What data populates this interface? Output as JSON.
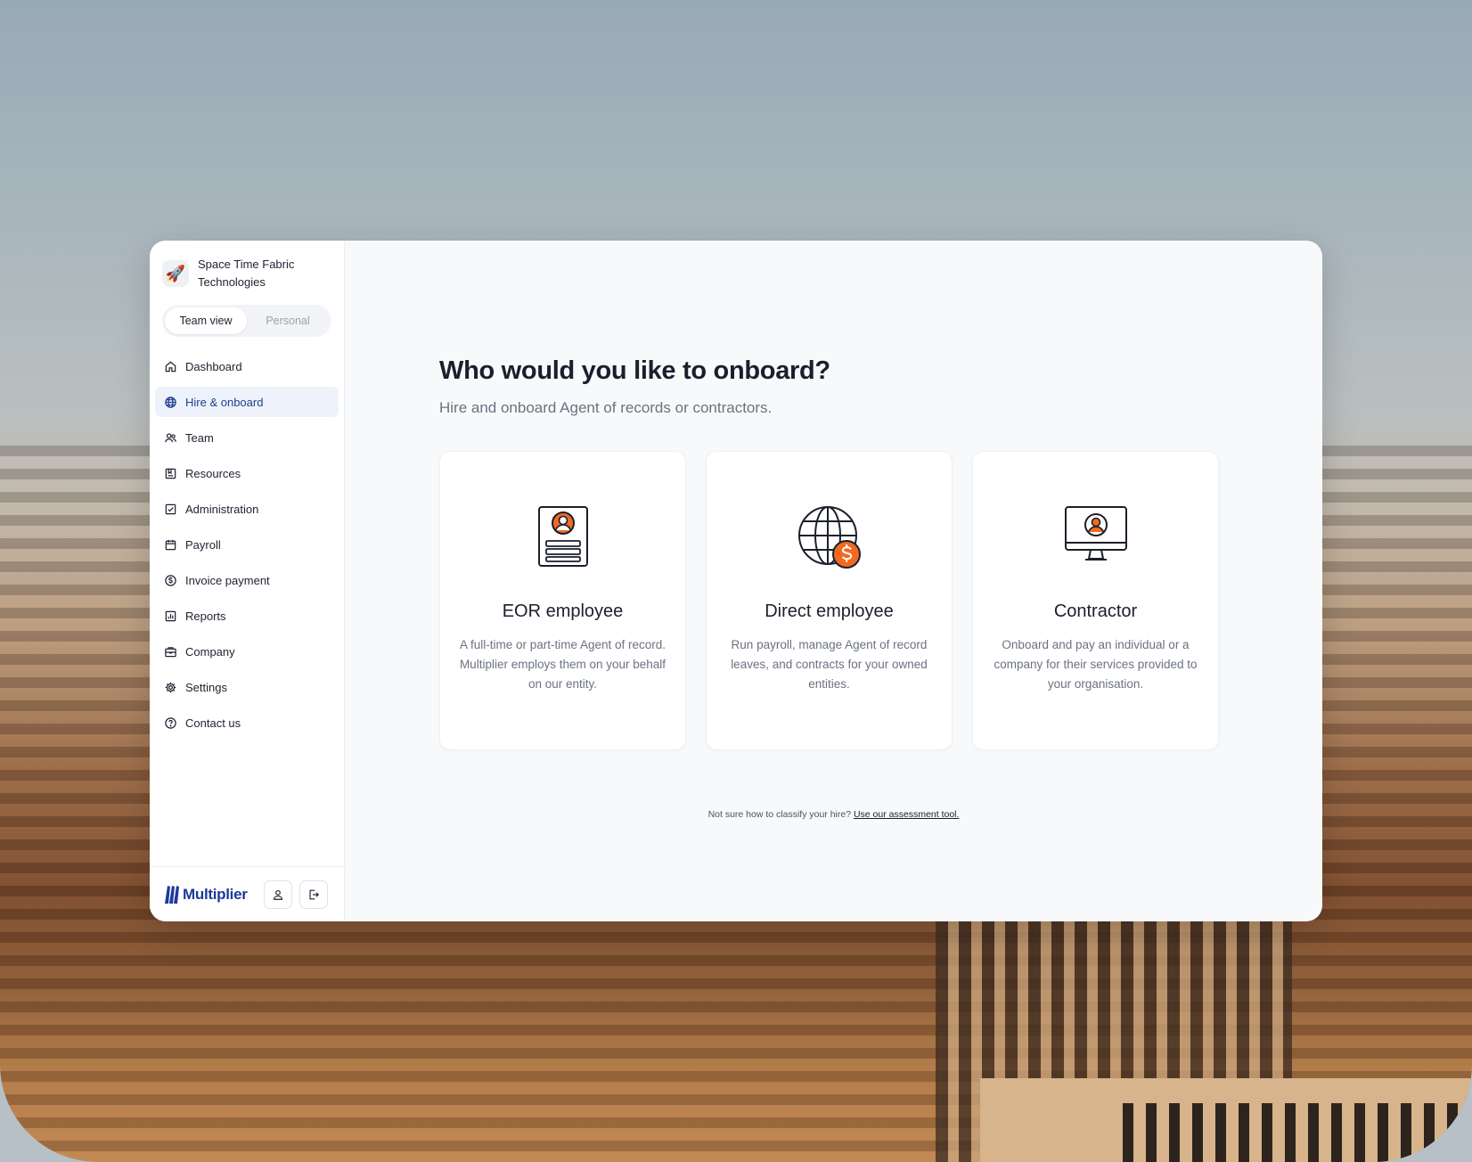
{
  "org": {
    "name": "Space Time Fabric Technologies",
    "logo_icon": "rocket-icon"
  },
  "view_toggle": {
    "team_label": "Team view",
    "personal_label": "Personal",
    "selected": "Team view"
  },
  "sidebar": {
    "items": [
      {
        "label": "Dashboard",
        "icon": "home-icon"
      },
      {
        "label": "Hire & onboard",
        "icon": "globe-icon",
        "active": true
      },
      {
        "label": "Team",
        "icon": "users-icon"
      },
      {
        "label": "Resources",
        "icon": "book-icon"
      },
      {
        "label": "Administration",
        "icon": "checklist-icon"
      },
      {
        "label": "Payroll",
        "icon": "calendar-icon"
      },
      {
        "label": "Invoice payment",
        "icon": "dollar-circle-icon"
      },
      {
        "label": "Reports",
        "icon": "bar-chart-icon"
      },
      {
        "label": "Company",
        "icon": "briefcase-icon"
      },
      {
        "label": "Settings",
        "icon": "gear-icon"
      },
      {
        "label": "Contact us",
        "icon": "help-circle-icon"
      }
    ]
  },
  "footer": {
    "brand": "Multiplier",
    "profile_icon": "user-icon",
    "logout_icon": "logout-icon"
  },
  "main": {
    "heading": "Who would you like to onboard?",
    "subheading": "Hire and onboard Agent of records or contractors.",
    "cards": [
      {
        "title": "EOR employee",
        "description": "A full-time or part-time Agent of record. Multiplier employs them on your behalf on our entity.",
        "icon": "id-card-icon"
      },
      {
        "title": "Direct employee",
        "description": "Run payroll, manage Agent of record leaves, and contracts for your owned entities.",
        "icon": "globe-dollar-icon"
      },
      {
        "title": "Contractor",
        "description": "Onboard and pay an individual or a company for their services provided to your organisation.",
        "icon": "monitor-user-icon"
      }
    ],
    "footnote_text": "Not sure how to classify your hire?",
    "footnote_link": "Use our assessment tool."
  },
  "colors": {
    "accent": "#1f3f8f",
    "active_bg": "#eef3fb",
    "icon_orange": "#f26a21",
    "brand_blue": "#1d3a9a"
  }
}
